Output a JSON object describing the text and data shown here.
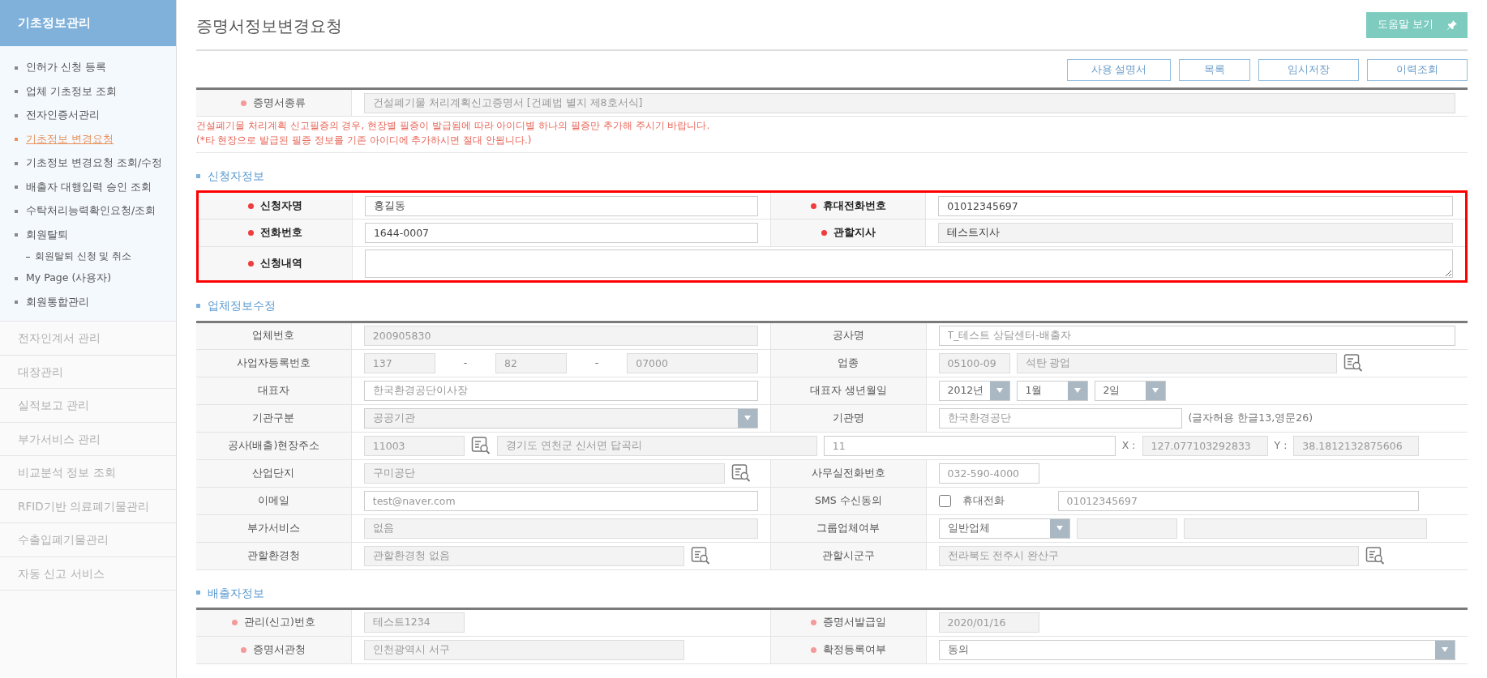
{
  "sidebar": {
    "title": "기초정보관리",
    "items": [
      {
        "label": "인허가 신청 등록",
        "selected": false
      },
      {
        "label": "업체 기초정보 조회",
        "selected": false
      },
      {
        "label": "전자인증서관리",
        "selected": false
      },
      {
        "label": "기초정보 변경요청",
        "selected": true
      },
      {
        "label": "기초정보 변경요청 조회/수정",
        "selected": false
      },
      {
        "label": "배출자 대행입력 승인 조회",
        "selected": false
      },
      {
        "label": "수탁처리능력확인요청/조회",
        "selected": false
      },
      {
        "label": "회원탈퇴",
        "selected": false,
        "children": [
          {
            "label": "회원탈퇴 신청 및 취소",
            "selected": false
          }
        ]
      },
      {
        "label": "My Page (사용자)",
        "selected": false
      },
      {
        "label": "회원통합관리",
        "selected": false
      }
    ],
    "menus": [
      "전자인계서 관리",
      "대장관리",
      "실적보고 관리",
      "부가서비스 관리",
      "비교분석 정보 조회",
      "RFID기반 의료폐기물관리",
      "수출입폐기물관리",
      "자동 신고 서비스"
    ]
  },
  "page": {
    "title": "증명서정보변경요청",
    "help_button": "도움말 보기",
    "actions": [
      "사용 설명서",
      "목록",
      "임시저장",
      "이력조회"
    ]
  },
  "sections": [
    {
      "highlighted": false,
      "rows": [
        {
          "cells": [
            {
              "label": "증명서종류",
              "required": true,
              "fields": [
                {
                  "kind": "input",
                  "value": "건설폐기물 처리계획신고증명서 [건폐법 별지 제8호서식]",
                  "disabled": true
                }
              ]
            }
          ]
        }
      ],
      "notice": [
        "건설폐기물 처리계획 신고필증의 경우, 현장별 필증이 발급됨에 따라 아이디별 하나의 필증만 추가해 주시기 바랍니다.",
        "(*타 현장으로 발급된 필증 정보를 기존 아이디에 추가하시면 절대 안됩니다.)"
      ]
    },
    {
      "title": "신청자정보",
      "highlighted": true,
      "rows": [
        {
          "cells": [
            {
              "label": "신청자명",
              "required": true,
              "fields": [
                {
                  "kind": "input",
                  "value": "홍길동",
                  "disabled": false
                }
              ]
            },
            {
              "label": "휴대전화번호",
              "required": true,
              "fields": [
                {
                  "kind": "input",
                  "value": "01012345697",
                  "disabled": false
                }
              ]
            }
          ]
        },
        {
          "cells": [
            {
              "label": "전화번호",
              "required": true,
              "fields": [
                {
                  "kind": "input",
                  "value": "1644-0007",
                  "disabled": false
                }
              ]
            },
            {
              "label": "관할지사",
              "required": true,
              "fields": [
                {
                  "kind": "input",
                  "value": "테스트지사",
                  "disabled": true
                }
              ]
            }
          ]
        },
        {
          "cells": [
            {
              "label": "신청내역",
              "required": true,
              "fields": [
                {
                  "kind": "textarea"
                }
              ]
            }
          ]
        }
      ]
    },
    {
      "title": "업체정보수정",
      "highlighted": false,
      "rows": [
        {
          "cells": [
            {
              "label": "업체번호",
              "required": false,
              "fields": [
                {
                  "kind": "input",
                  "value": "200905830",
                  "disabled": true
                }
              ]
            },
            {
              "label": "공사명",
              "required": false,
              "fields": [
                {
                  "kind": "input",
                  "value": "T_테스트 상담센터-배출자",
                  "disabled": false
                }
              ]
            }
          ]
        },
        {
          "cells": [
            {
              "label": "사업자등록번호",
              "required": false,
              "fields": [
                {
                  "kind": "input",
                  "value": "137",
                  "disabled": true
                },
                {
                  "kind": "dash",
                  "text": "-"
                },
                {
                  "kind": "input",
                  "value": "82",
                  "disabled": true
                },
                {
                  "kind": "dash",
                  "text": "-"
                },
                {
                  "kind": "input",
                  "value": "07000",
                  "disabled": true
                }
              ]
            },
            {
              "label": "업종",
              "required": false,
              "fields": [
                {
                  "kind": "input",
                  "value": "05100-09",
                  "disabled": true
                },
                {
                  "kind": "input",
                  "value": "석탄 광업",
                  "disabled": true
                },
                {
                  "kind": "search"
                }
              ]
            }
          ]
        },
        {
          "cells": [
            {
              "label": "대표자",
              "required": false,
              "fields": [
                {
                  "kind": "input",
                  "value": "한국환경공단이사장",
                  "disabled": false
                }
              ]
            },
            {
              "label": "대표자 생년월일",
              "required": false,
              "fields": [
                {
                  "kind": "select",
                  "value": "2012년",
                  "disabled": false
                },
                {
                  "kind": "select",
                  "value": "1월",
                  "disabled": false
                },
                {
                  "kind": "select",
                  "value": "2일",
                  "disabled": false
                }
              ]
            }
          ]
        },
        {
          "cells": [
            {
              "label": "기관구분",
              "required": false,
              "fields": [
                {
                  "kind": "select",
                  "value": "공공기관",
                  "disabled": true
                }
              ]
            },
            {
              "label": "기관명",
              "required": false,
              "fields": [
                {
                  "kind": "input",
                  "value": "한국환경공단",
                  "disabled": false
                },
                {
                  "kind": "note",
                  "text": "(글자허용 한글13,영문26)"
                }
              ]
            }
          ]
        },
        {
          "cells": [
            {
              "label": "공사(배출)현장주소",
              "required": false,
              "fields": [
                {
                  "kind": "input",
                  "value": "11003",
                  "disabled": true
                },
                {
                  "kind": "search"
                },
                {
                  "kind": "input",
                  "value": "경기도 연천군 신서면 답곡리",
                  "disabled": true
                },
                {
                  "kind": "input",
                  "value": "11",
                  "disabled": false
                },
                {
                  "kind": "note",
                  "text": "X :"
                },
                {
                  "kind": "input",
                  "value": "127.077103292833",
                  "disabled": true
                },
                {
                  "kind": "note",
                  "text": "Y :"
                },
                {
                  "kind": "input",
                  "value": "38.1812132875606",
                  "disabled": true
                }
              ]
            }
          ]
        },
        {
          "cells": [
            {
              "label": "산업단지",
              "required": false,
              "fields": [
                {
                  "kind": "input",
                  "value": "구미공단",
                  "disabled": true
                },
                {
                  "kind": "search"
                }
              ]
            },
            {
              "label": "사무실전화번호",
              "required": false,
              "fields": [
                {
                  "kind": "input",
                  "value": "032-590-4000",
                  "disabled": false
                }
              ]
            }
          ]
        },
        {
          "cells": [
            {
              "label": "이메일",
              "required": false,
              "fields": [
                {
                  "kind": "input",
                  "value": "test@naver.com",
                  "disabled": false
                }
              ]
            },
            {
              "label": "SMS 수신동의",
              "required": false,
              "fields": [
                {
                  "kind": "checkbox",
                  "text": "휴대전화",
                  "checked": false
                },
                {
                  "kind": "input",
                  "value": "01012345697",
                  "disabled": false
                }
              ]
            }
          ]
        },
        {
          "cells": [
            {
              "label": "부가서비스",
              "required": false,
              "fields": [
                {
                  "kind": "input",
                  "value": "없음",
                  "disabled": true
                }
              ]
            },
            {
              "label": "그룹업체여부",
              "required": false,
              "fields": [
                {
                  "kind": "select",
                  "value": "일반업체",
                  "disabled": false
                },
                {
                  "kind": "input",
                  "disabled": true
                },
                {
                  "kind": "input",
                  "disabled": true
                }
              ]
            }
          ]
        },
        {
          "cells": [
            {
              "label": "관할환경청",
              "required": false,
              "fields": [
                {
                  "kind": "input",
                  "value": "관할환경청 없음",
                  "disabled": true
                },
                {
                  "kind": "search"
                }
              ]
            },
            {
              "label": "관할시군구",
              "required": false,
              "fields": [
                {
                  "kind": "input",
                  "value": "전라북도 전주시 완산구",
                  "disabled": true
                },
                {
                  "kind": "search"
                }
              ]
            }
          ]
        }
      ]
    },
    {
      "title": "배출자정보",
      "highlighted": false,
      "rows": [
        {
          "cells": [
            {
              "label": "관리(신고)번호",
              "required": true,
              "fields": [
                {
                  "kind": "input",
                  "value": "테스트1234",
                  "disabled": true
                }
              ]
            },
            {
              "label": "증명서발급일",
              "required": true,
              "fields": [
                {
                  "kind": "input",
                  "value": "2020/01/16",
                  "disabled": true
                }
              ]
            }
          ]
        },
        {
          "cells": [
            {
              "label": "증명서관청",
              "required": true,
              "fields": [
                {
                  "kind": "input",
                  "value": "인천광역시 서구",
                  "disabled": true
                }
              ]
            },
            {
              "label": "확정등록여부",
              "required": true,
              "fields": [
                {
                  "kind": "select",
                  "value": "동의",
                  "disabled": false
                }
              ]
            }
          ]
        }
      ]
    }
  ]
}
